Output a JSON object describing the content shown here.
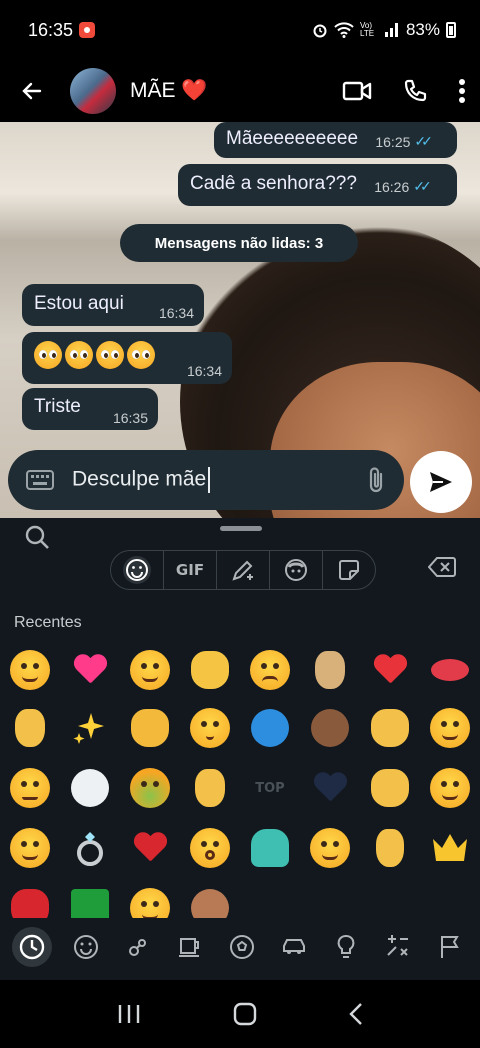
{
  "status": {
    "time": "16:35",
    "battery": "83%",
    "net_label": "Vo) LTE"
  },
  "header": {
    "contact_name": "MÃE ❤️"
  },
  "messages": {
    "out1": {
      "text": "Mãeeeeeeeeee",
      "time": "16:25"
    },
    "out2": {
      "text": "Cadê a senhora???",
      "time": "16:26"
    },
    "unread": "Mensagens não lidas: 3",
    "in1": {
      "text": "Estou aqui",
      "time": "16:34"
    },
    "in2": {
      "time": "16:34",
      "emoji": "🥺🥺🥺🥺"
    },
    "in3": {
      "text": "Triste",
      "time": "16:35"
    }
  },
  "input": {
    "value": "Desculpe mãe"
  },
  "keyboard": {
    "section_label": "Recentes",
    "gif_label": "GIF",
    "top_label": "TOP"
  },
  "colors": {
    "bubble": "#1f2c33",
    "tick": "#53bdeb",
    "keyboard_bg": "#12181d"
  }
}
